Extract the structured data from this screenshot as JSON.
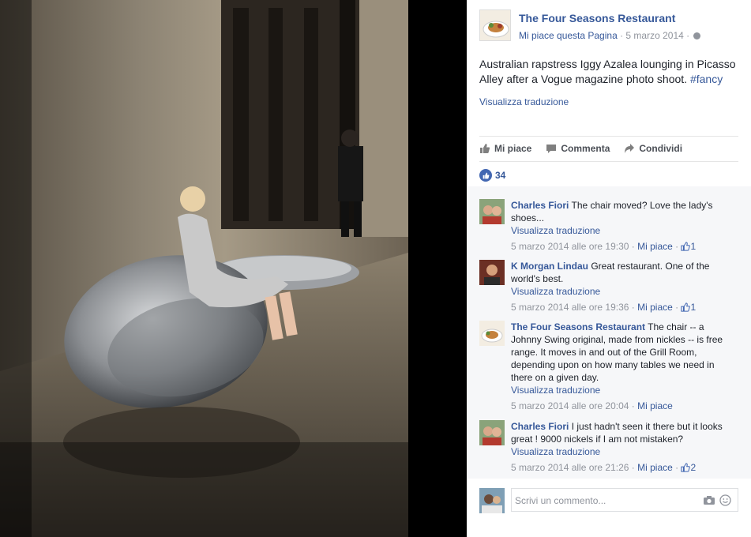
{
  "post": {
    "page_name": "The Four Seasons Restaurant",
    "like_page": "Mi piace questa Pagina",
    "separator": " · ",
    "date": "5 marzo 2014",
    "text": "Australian rapstress Iggy Azalea lounging in Picasso Alley after a Vogue magazine photo shoot.",
    "hashtag": "#fancy",
    "see_translation": "Visualizza traduzione"
  },
  "actions": {
    "like": "Mi piace",
    "comment": "Commenta",
    "share": "Condividi"
  },
  "likes_count": "34",
  "comments": [
    {
      "author": "Charles Fiori",
      "text": "The chair moved? Love the lady's shoes...",
      "translation": "Visualizza traduzione",
      "timestamp": "5 marzo 2014 alle ore 19:30",
      "like_label": "Mi piace",
      "likes": "1"
    },
    {
      "author": "K Morgan Lindau",
      "text": "Great restaurant. One of the world's best.",
      "translation": "Visualizza traduzione",
      "timestamp": "5 marzo 2014 alle ore 19:36",
      "like_label": "Mi piace",
      "likes": "1"
    },
    {
      "author": "The Four Seasons Restaurant",
      "text": "The chair -- a Johnny Swing original, made from nickles -- is free range. It moves in and out of the Grill Room, depending upon on how many tables we need in there on a given day.",
      "translation": "Visualizza traduzione",
      "timestamp": "5 marzo 2014 alle ore 20:04",
      "like_label": "Mi piace",
      "likes": ""
    },
    {
      "author": "Charles Fiori",
      "text": "I just hadn't seen it there but it looks great ! 9000 nickels if I am not mistaken?",
      "translation": "Visualizza traduzione",
      "timestamp": "5 marzo 2014 alle ore 21:26",
      "like_label": "Mi piace",
      "likes": "2"
    }
  ],
  "composer": {
    "placeholder": "Scrivi un commento..."
  },
  "colors": {
    "link_blue": "#365899",
    "like_blue": "#4267b2",
    "meta_gray": "#90949c",
    "comments_bg": "#f6f7f9"
  },
  "icons": [
    "thumbs-up-icon",
    "comment-icon",
    "share-icon",
    "globe-icon",
    "camera-icon",
    "emoji-icon"
  ]
}
